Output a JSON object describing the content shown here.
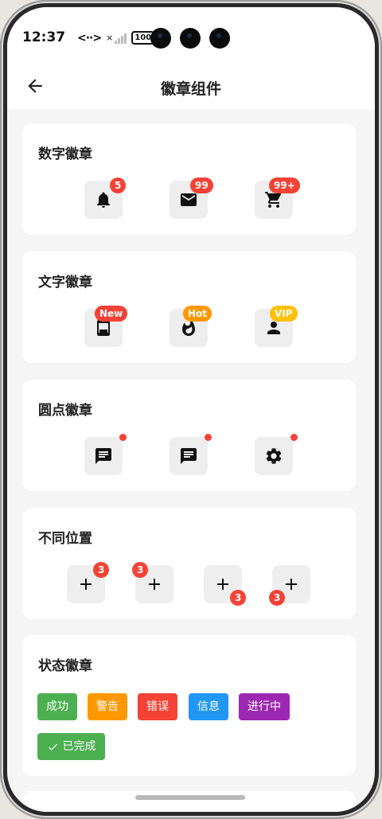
{
  "status_bar": {
    "time": "12:37",
    "data_arrows": "<··>",
    "signal_x": "×",
    "battery": "100"
  },
  "header": {
    "title": "徽章组件"
  },
  "sections": {
    "number": {
      "title": "数字徽章",
      "items": [
        {
          "icon": "bell-icon",
          "badge": "5"
        },
        {
          "icon": "mail-icon",
          "badge": "99"
        },
        {
          "icon": "cart-icon",
          "badge": "99+"
        }
      ]
    },
    "text": {
      "title": "文字徽章",
      "items": [
        {
          "icon": "tablet-icon",
          "badge": "New",
          "color": "#f44336"
        },
        {
          "icon": "fire-icon",
          "badge": "Hot",
          "color": "#ff9800"
        },
        {
          "icon": "person-icon",
          "badge": "VIP",
          "color": "#ffc107"
        }
      ]
    },
    "dot": {
      "title": "圆点徽章",
      "items": [
        {
          "icon": "chat-icon"
        },
        {
          "icon": "chat-icon"
        },
        {
          "icon": "gear-icon"
        }
      ]
    },
    "position": {
      "title": "不同位置",
      "items": [
        {
          "icon": "plus-icon",
          "badge": "3",
          "position": "top-right"
        },
        {
          "icon": "plus-icon",
          "badge": "3",
          "position": "top-left"
        },
        {
          "icon": "plus-icon",
          "badge": "3",
          "position": "bottom-right"
        },
        {
          "icon": "plus-icon",
          "badge": "3",
          "position": "bottom-left"
        }
      ]
    },
    "status": {
      "title": "状态徽章",
      "tags": [
        {
          "label": "成功",
          "color": "#4caf50"
        },
        {
          "label": "警告",
          "color": "#ff9800"
        },
        {
          "label": "错误",
          "color": "#f44336"
        },
        {
          "label": "信息",
          "color": "#2196f3"
        },
        {
          "label": "进行中",
          "color": "#9c27b0"
        },
        {
          "label": "已完成",
          "color": "#4caf50",
          "icon": "check-icon"
        }
      ]
    }
  }
}
